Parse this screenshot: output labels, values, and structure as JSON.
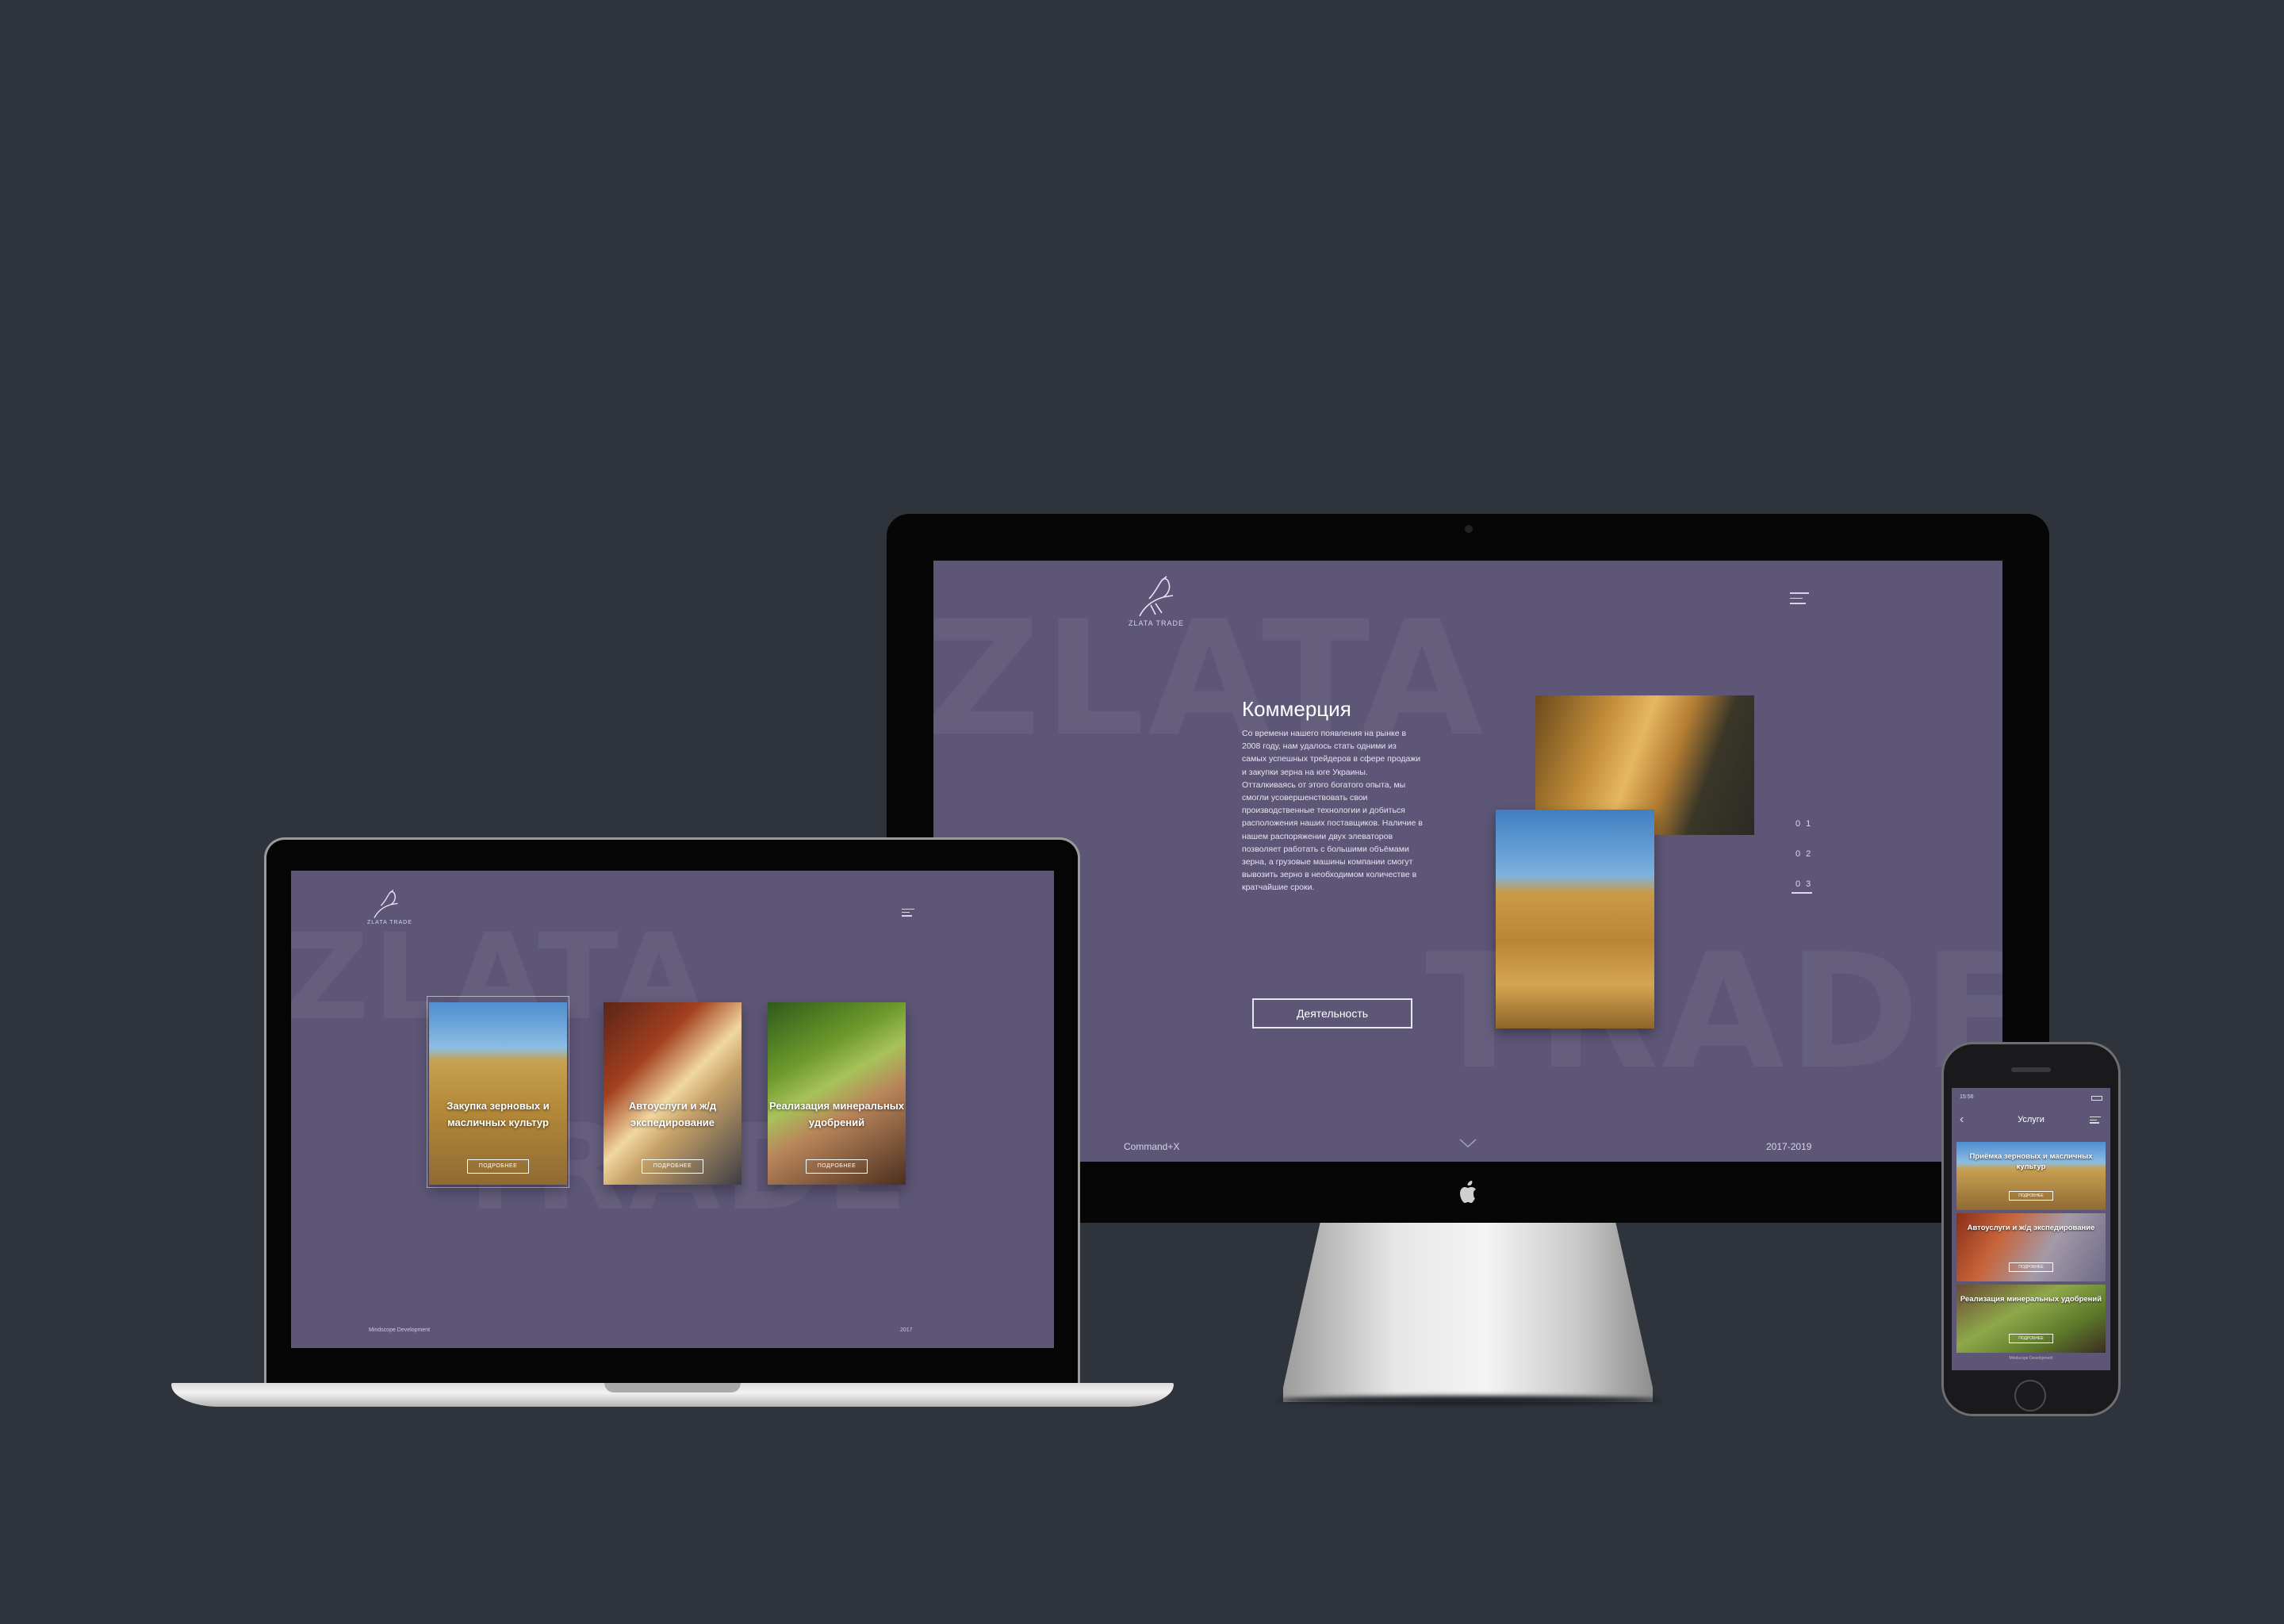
{
  "brand": {
    "name": "ZLATA TRADE",
    "watermark_top": "ZLATA",
    "watermark_bottom": "TRADE"
  },
  "imac": {
    "title": "Коммерция",
    "body": "Со времени нашего появления на рынке в 2008 году, нам удалось стать одними из самых успешных трейдеров в сфере продажи и закупки зерна на юге Украины. Отталкиваясь от этого богатого опыта, мы смогли усовершенствовать свои производственные технологии и добиться расположения наших поставщиков. Наличие в нашем распоряжении двух элеваторов позволяет работать с большими объёмами зерна, а грузовые машины компании смогут вывозить зерно в необходимом количестве в кратчайшие сроки.",
    "button": "Деятельность",
    "pagination": [
      "0 1",
      "0 2",
      "0 3"
    ],
    "active_page": 3,
    "footer_left": "Command+X",
    "footer_right": "2017-2019"
  },
  "laptop": {
    "cards": [
      {
        "title": "Закупка зерновых и масличных культур",
        "button": "ПОДРОБНЕЕ"
      },
      {
        "title": "Автоуслуги и ж/д экспедирование",
        "button": "ПОДРОБНЕЕ"
      },
      {
        "title": "Реализация минеральных удобрений",
        "button": "ПОДРОБНЕЕ"
      }
    ],
    "footer_left": "Mindscope Development",
    "footer_right": "2017"
  },
  "phone": {
    "status_time": "15:56",
    "title": "Услуги",
    "cards": [
      {
        "title": "Приёмка зерновых и масличных культур",
        "button": "ПОДРОБНЕЕ"
      },
      {
        "title": "Автоуслуги и ж/д экспедирование",
        "button": "ПОДРОБНЕЕ"
      },
      {
        "title": "Реализация минеральных удобрений",
        "button": "ПОДРОБНЕЕ"
      }
    ],
    "footer": "Mindscope Development"
  },
  "colors": {
    "background": "#2f343c",
    "screen_purple": "#5d5677",
    "text_light": "#e7e4f0"
  }
}
